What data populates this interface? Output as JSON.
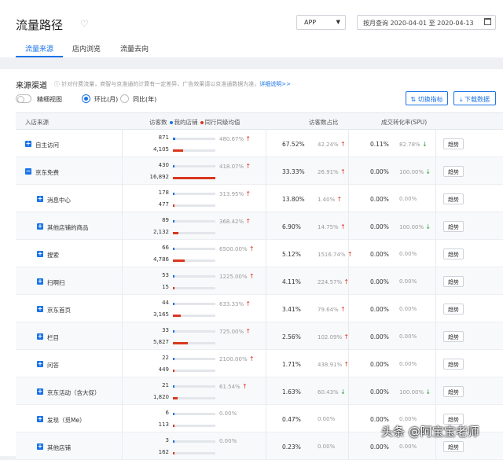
{
  "header": {
    "title": "流量路径",
    "platform": "APP",
    "date_mode": "按月查询",
    "date_range": "2020-04-01 至 2020-04-13",
    "tabs": [
      {
        "label": "流量来源",
        "active": true
      },
      {
        "label": "店内浏览",
        "active": false
      },
      {
        "label": "流量去向",
        "active": false
      }
    ]
  },
  "section": {
    "title": "来源渠道",
    "note": "针对付费流量，商智与京准通的计算有一定差异，广告效果请以京准通数据为准，",
    "link": "详细说明>>",
    "toggle_label": "精细视图",
    "radio1": "环比(月)",
    "radio2": "同比(年)",
    "switch_btn": "切换指标",
    "download_btn": "下载数据"
  },
  "table": {
    "headers": {
      "source": "入店来源",
      "visitors": "访客数",
      "my_store": "我的店铺",
      "peer_avg": "同行同级均值",
      "share": "访客数占比",
      "conversion": "成交转化率(SPU)"
    },
    "trend_label": "趋势",
    "rows": [
      {
        "expand": "+",
        "level": 0,
        "name": "自主访问",
        "my": "871",
        "peer": "4,105",
        "my_frac": 0.052,
        "peer_frac": 0.243,
        "chg": "480.67%",
        "chg_dir": "up",
        "share": "67.52%",
        "share_chg": "42.24%",
        "share_dir": "up",
        "conv": "0.11%",
        "conv_chg": "82.78%",
        "conv_dir": "down"
      },
      {
        "expand": "−",
        "level": 0,
        "name": "京东免费",
        "my": "430",
        "peer": "16,892",
        "my_frac": 0.025,
        "peer_frac": 1.0,
        "chg": "418.07%",
        "chg_dir": "up",
        "share": "33.33%",
        "share_chg": "26.91%",
        "share_dir": "up",
        "conv": "0.00%",
        "conv_chg": "100.00%",
        "conv_dir": "down"
      },
      {
        "expand": "+",
        "level": 1,
        "name": "消息中心",
        "my": "178",
        "peer": "477",
        "my_frac": 0.011,
        "peer_frac": 0.028,
        "chg": "313.95%",
        "chg_dir": "up",
        "share": "13.80%",
        "share_chg": "1.40%",
        "share_dir": "up",
        "conv": "0.00%",
        "conv_chg": "0.00%",
        "conv_dir": ""
      },
      {
        "expand": "+",
        "level": 1,
        "name": "其他店铺的商品",
        "my": "89",
        "peer": "2,132",
        "my_frac": 0.005,
        "peer_frac": 0.126,
        "chg": "368.42%",
        "chg_dir": "up",
        "share": "6.90%",
        "share_chg": "14.75%",
        "share_dir": "up",
        "conv": "0.00%",
        "conv_chg": "100.00%",
        "conv_dir": "down"
      },
      {
        "expand": "+",
        "level": 1,
        "name": "搜索",
        "my": "66",
        "peer": "4,786",
        "my_frac": 0.004,
        "peer_frac": 0.283,
        "chg": "6500.00%",
        "chg_dir": "up",
        "share": "5.12%",
        "share_chg": "1516.74%",
        "share_dir": "up",
        "conv": "0.00%",
        "conv_chg": "0.00%",
        "conv_dir": ""
      },
      {
        "expand": "+",
        "level": 1,
        "name": "扫啊扫",
        "my": "53",
        "peer": "15",
        "my_frac": 0.003,
        "peer_frac": 0.001,
        "chg": "1225.00%",
        "chg_dir": "up",
        "share": "4.11%",
        "share_chg": "224.57%",
        "share_dir": "up",
        "conv": "0.00%",
        "conv_chg": "0.00%",
        "conv_dir": ""
      },
      {
        "expand": "+",
        "level": 1,
        "name": "京东首页",
        "my": "44",
        "peer": "3,165",
        "my_frac": 0.003,
        "peer_frac": 0.187,
        "chg": "633.33%",
        "chg_dir": "up",
        "share": "3.41%",
        "share_chg": "79.64%",
        "share_dir": "up",
        "conv": "0.00%",
        "conv_chg": "0.00%",
        "conv_dir": ""
      },
      {
        "expand": "+",
        "level": 1,
        "name": "栏目",
        "my": "33",
        "peer": "5,827",
        "my_frac": 0.002,
        "peer_frac": 0.345,
        "chg": "725.00%",
        "chg_dir": "up",
        "share": "2.56%",
        "share_chg": "102.09%",
        "share_dir": "up",
        "conv": "0.00%",
        "conv_chg": "0.00%",
        "conv_dir": ""
      },
      {
        "expand": "+",
        "level": 1,
        "name": "问答",
        "my": "22",
        "peer": "449",
        "my_frac": 0.001,
        "peer_frac": 0.027,
        "chg": "2100.00%",
        "chg_dir": "up",
        "share": "1.71%",
        "share_chg": "438.91%",
        "share_dir": "up",
        "conv": "0.00%",
        "conv_chg": "0.00%",
        "conv_dir": ""
      },
      {
        "expand": "+",
        "level": 1,
        "name": "京东活动（含大促）",
        "my": "21",
        "peer": "1,820",
        "my_frac": 0.001,
        "peer_frac": 0.108,
        "chg": "61.54%",
        "chg_dir": "up",
        "share": "1.63%",
        "share_chg": "60.43%",
        "share_dir": "down",
        "conv": "0.00%",
        "conv_chg": "100.00%",
        "conv_dir": "down"
      },
      {
        "expand": "+",
        "level": 1,
        "name": "发现（觅Me）",
        "my": "6",
        "peer": "113",
        "my_frac": 0.0004,
        "peer_frac": 0.007,
        "chg": "0.00%",
        "chg_dir": "",
        "share": "0.47%",
        "share_chg": "0.00%",
        "share_dir": "",
        "conv": "0.00%",
        "conv_chg": "0.00%",
        "conv_dir": ""
      },
      {
        "expand": "+",
        "level": 1,
        "name": "其他店铺",
        "my": "3",
        "peer": "162",
        "my_frac": 0.0002,
        "peer_frac": 0.01,
        "chg": "0.00%",
        "chg_dir": "",
        "share": "0.23%",
        "share_chg": "0.00%",
        "share_dir": "",
        "conv": "0.00%",
        "conv_chg": "0.00%",
        "conv_dir": ""
      }
    ]
  },
  "colors": {
    "accent": "#1a73e8",
    "peer": "#d9381e",
    "up": "#d9381e",
    "down": "#2ea043"
  },
  "watermark": "头条 @阿宝宝老师"
}
